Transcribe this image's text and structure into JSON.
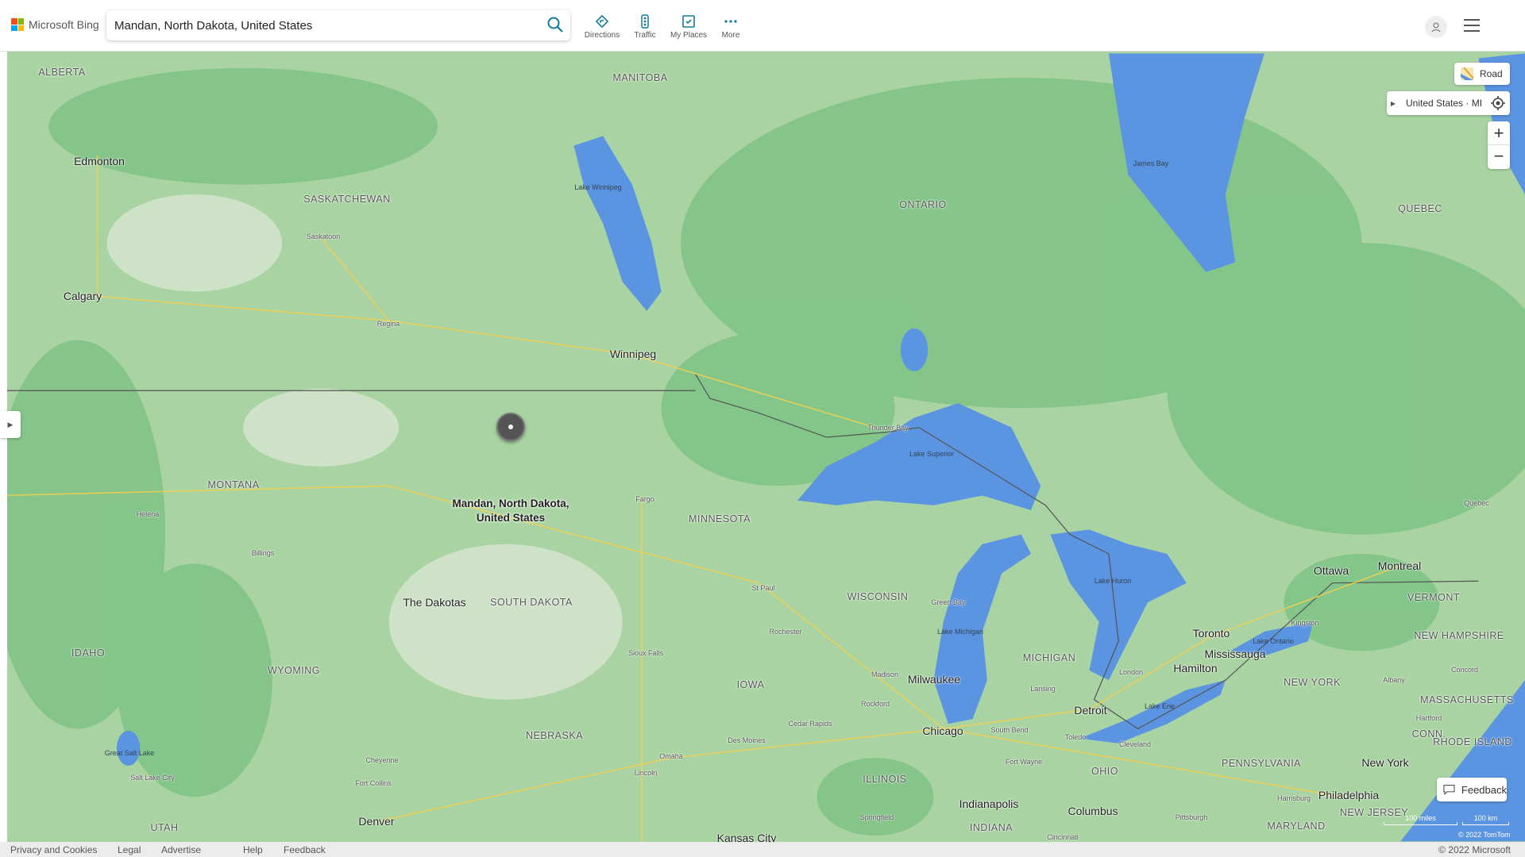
{
  "header": {
    "brand": "Microsoft Bing",
    "search_value": "Mandan, North Dakota, United States",
    "nav": [
      {
        "label": "Directions",
        "icon": "directions-icon"
      },
      {
        "label": "Traffic",
        "icon": "traffic-icon"
      },
      {
        "label": "My Places",
        "icon": "my-places-icon"
      },
      {
        "label": "More",
        "icon": "more-icon"
      }
    ]
  },
  "map_controls": {
    "style_label": "Road",
    "location_label": "United States · MI",
    "feedback_label": "Feedback",
    "scale_miles": "100 miles",
    "scale_km": "100 km",
    "copyright_map": "© 2022 TomTom"
  },
  "pin": {
    "line1": "Mandan, North Dakota,",
    "line2": "United States"
  },
  "labels": {
    "states": [
      "ALBERTA",
      "MANITOBA",
      "SASKATCHEWAN",
      "ONTARIO",
      "QUEBEC",
      "MONTANA",
      "MINNESOTA",
      "SOUTH DAKOTA",
      "WISCONSIN",
      "IDAHO",
      "WYOMING",
      "MICHIGAN",
      "IOWA",
      "NEBRASKA",
      "UTAH",
      "ILLINOIS",
      "INDIANA",
      "OHIO",
      "PENNSYLVANIA",
      "NEW YORK",
      "VERMONT",
      "NEW HAMPSHIRE",
      "MASSACHUSETTS",
      "CONN.",
      "RHODE ISLAND",
      "NEW JERSEY",
      "MARYLAND"
    ],
    "cities_big": [
      "Edmonton",
      "Calgary",
      "Winnipeg",
      "Milwaukee",
      "Chicago",
      "Detroit",
      "Toronto",
      "Mississauga",
      "Hamilton",
      "Ottawa",
      "Montreal",
      "Indianapolis",
      "Columbus",
      "Denver",
      "Philadelphia",
      "New York",
      "Kansas City",
      "The Dakotas"
    ],
    "cities_small": [
      "Saskatoon",
      "Regina",
      "Thunder Bay",
      "Helena",
      "Billings",
      "Fargo",
      "St Paul",
      "Green Bay",
      "Sioux Falls",
      "Rochester",
      "Madison",
      "Lansing",
      "London",
      "Kingston",
      "Quebec",
      "Albany",
      "Concord",
      "Hartford",
      "Rockford",
      "Cedar Rapids",
      "Des Moines",
      "Omaha",
      "Lincoln",
      "Cheyenne",
      "Fort Collins",
      "Salt Lake City",
      "Springfield",
      "Fort Wayne",
      "South Bend",
      "Toledo",
      "Cleveland",
      "Cincinnati",
      "Harrisburg",
      "Pittsburgh"
    ],
    "water": [
      "James Bay",
      "Lake Winnipeg",
      "Lake Superior",
      "Lake Michigan",
      "Lake Huron",
      "Lake Ontario",
      "Lake Erie",
      "Great Salt Lake"
    ]
  },
  "footer": {
    "links": [
      "Privacy and Cookies",
      "Legal",
      "Advertise",
      "Help",
      "Feedback"
    ],
    "copyright": "© 2022 Microsoft"
  },
  "colors": {
    "land": "#a9d3a2",
    "forest": "#7cc283",
    "water": "#5b94e0",
    "accent": "#0f7a9c"
  }
}
